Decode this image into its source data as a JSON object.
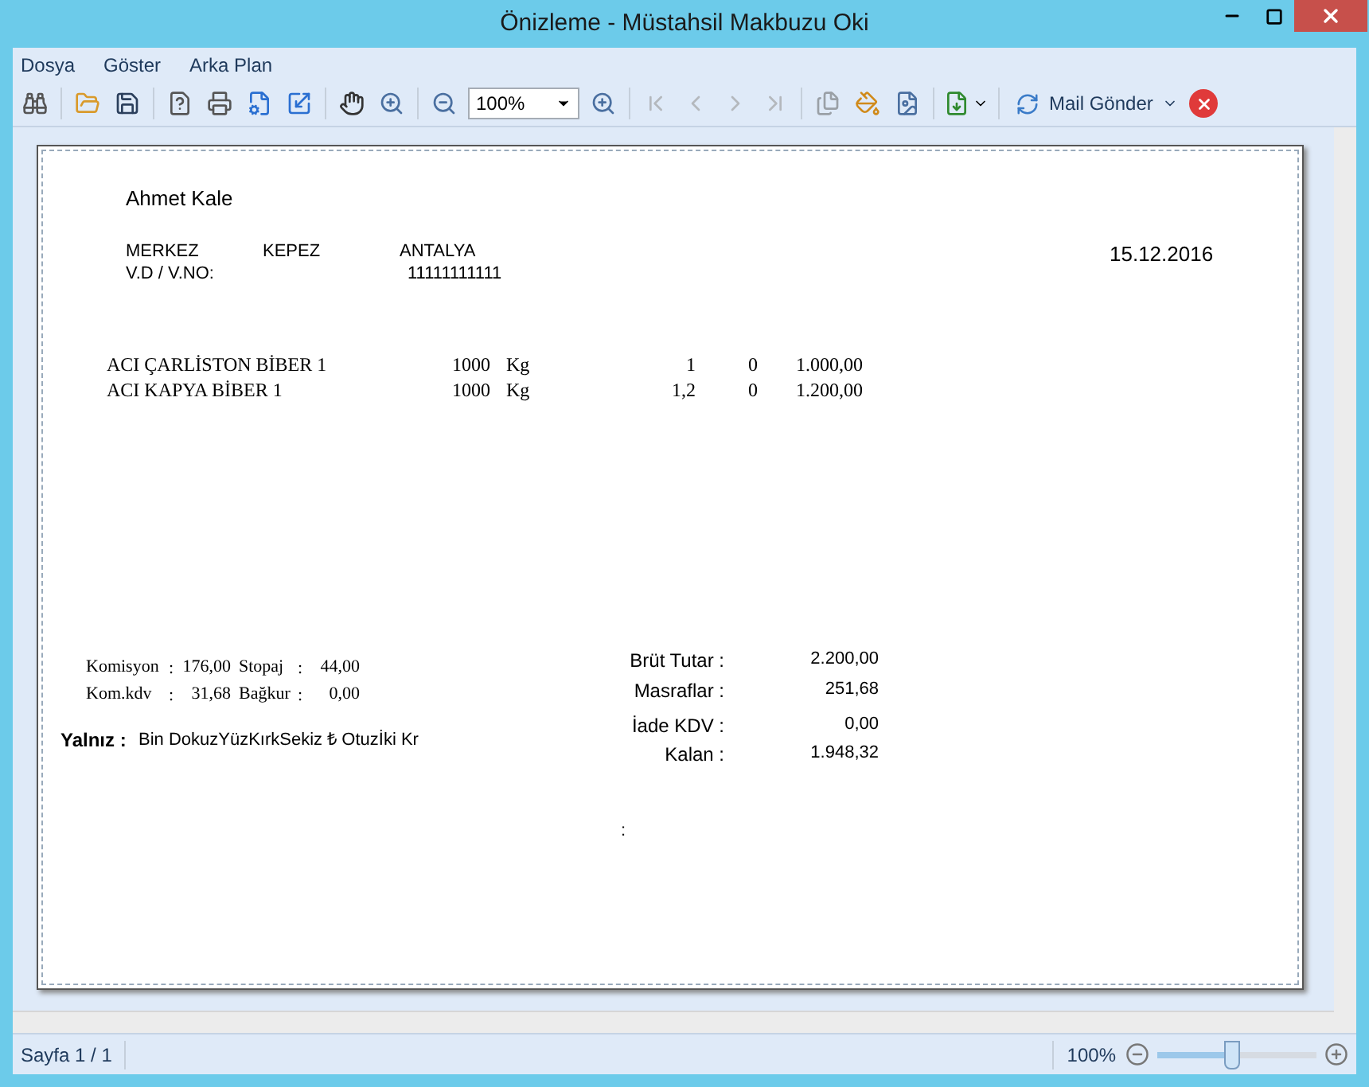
{
  "window": {
    "title": "Önizleme - Müstahsil Makbuzu Oki"
  },
  "menu": [
    "Dosya",
    "Göster",
    "Arka Plan"
  ],
  "toolbar": {
    "zoom_value": "100%",
    "navigation": [
      {
        "disabled": true
      },
      {
        "disabled": true
      },
      {
        "disabled": true
      },
      {
        "disabled": true
      }
    ],
    "mail_button": "Mail Gönder"
  },
  "document": {
    "name": "Ahmet Kale",
    "address": [
      "MERKEZ",
      "KEPEZ",
      "ANTALYA"
    ],
    "tax_label": "V.D / V.NO:",
    "tax_number": "11111111111",
    "date": "15.12.2016",
    "rows": [
      {
        "product": "ACI ÇARLİSTON BİBER 1",
        "quantity": "1000",
        "unit": "Kg",
        "column_4": "1",
        "column_5": "0",
        "amount": "1.000,00"
      },
      {
        "product": "ACI KAPYA BİBER 1",
        "quantity": "1000",
        "unit": "Kg",
        "column_4": "1,2",
        "column_5": "0",
        "amount": "1.200,00"
      }
    ],
    "deductions": [
      {
        "label": "Komisyon",
        "separator": ":",
        "value": "176,00",
        "label_2": "Stopaj",
        "separator_2": ":",
        "value_2": "44,00"
      },
      {
        "label": "Kom.kdv",
        "separator": ":",
        "value": "31,68",
        "label_2": "Bağkur",
        "separator_2": ":",
        "value_2": "0,00"
      }
    ],
    "in_words_label": "Yalnız :",
    "in_words": "Bin DokuzYüzKırkSekiz ₺ Otuzİki Kr",
    "totals": [
      {
        "label": "Brüt Tutar :",
        "value": "2.200,00"
      },
      {
        "label": "Masraflar :",
        "value": "251,68"
      },
      {
        "label": "İade KDV :",
        "value": "0,00"
      },
      {
        "label": "Kalan :",
        "value": "1.948,32"
      }
    ],
    "footer_mark": ":"
  },
  "status_bar": {
    "page": "Sayfa 1 / 1",
    "zoom": "100%",
    "zoom_slider": {
      "level": 0.47
    }
  }
}
